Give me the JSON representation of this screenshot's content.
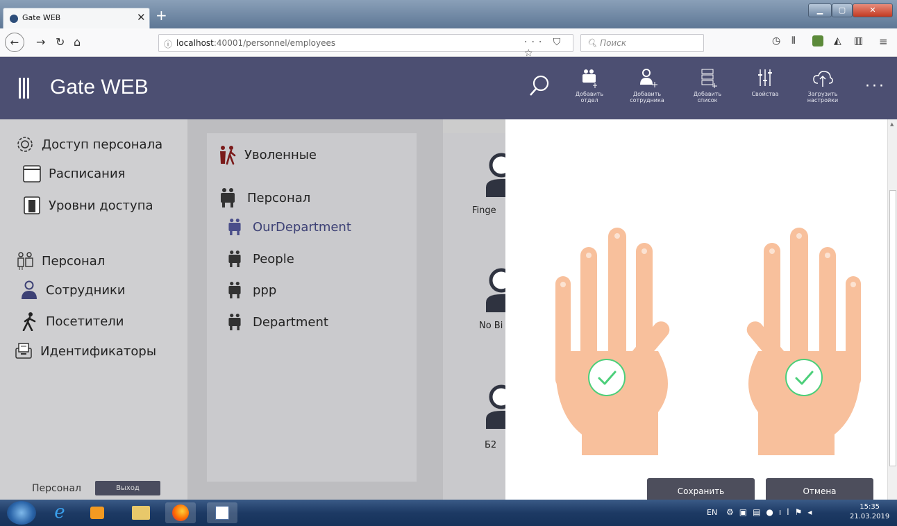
{
  "browser": {
    "tab_title": "Gate WEB",
    "tab_close": "✕",
    "new_tab": "+",
    "url_host": "localhost",
    "url_rest": ":40001/personnel/employees",
    "url_actions": "··· ⛉ ☆",
    "search_placeholder": "Поиск"
  },
  "app": {
    "title": "Gate WEB",
    "accent": "#4c4f72",
    "toolbar": [
      {
        "id": "add-dept",
        "label": "Добавить\nотдел",
        "icon": "department-add-icon"
      },
      {
        "id": "add-emp",
        "label": "Добавить\nсотрудника",
        "icon": "person-add-icon"
      },
      {
        "id": "add-list",
        "label": "Добавить\nсписок",
        "icon": "list-add-icon"
      },
      {
        "id": "props",
        "label": "Свойства",
        "icon": "sliders-icon"
      },
      {
        "id": "upload",
        "label": "Загрузить\nнастройки",
        "icon": "cloud-upload-icon"
      }
    ],
    "more": "···"
  },
  "sidebar": {
    "sections": [
      {
        "label": "Доступ персонала",
        "icon": "gear-icon",
        "header": true
      },
      {
        "label": "Расписания",
        "icon": "calendar-icon"
      },
      {
        "label": "Уровни доступа",
        "icon": "door-icon"
      },
      {
        "label": "Персонал",
        "icon": "staff-icon",
        "header": true
      },
      {
        "label": "Сотрудники",
        "icon": "person-icon"
      },
      {
        "label": "Посетители",
        "icon": "walker-icon"
      },
      {
        "label": "Идентификаторы",
        "icon": "card-tray-icon"
      }
    ],
    "footer_label": "Персонал",
    "exit_label": "Выход"
  },
  "departments": {
    "fired": "Уволенные",
    "personnel": "Персонал",
    "items": [
      "OurDepartment",
      "People",
      "ppp",
      "Department"
    ]
  },
  "employees": [
    "Finge",
    "No Bi",
    "Б2"
  ],
  "fingerprint": {
    "skin_color": "#f8c09c",
    "check_color": "#4ccf7a",
    "save_label": "Сохранить",
    "cancel_label": "Отмена"
  },
  "taskbar": {
    "lang": "EN",
    "time": "15:35",
    "date": "21.03.2019"
  }
}
